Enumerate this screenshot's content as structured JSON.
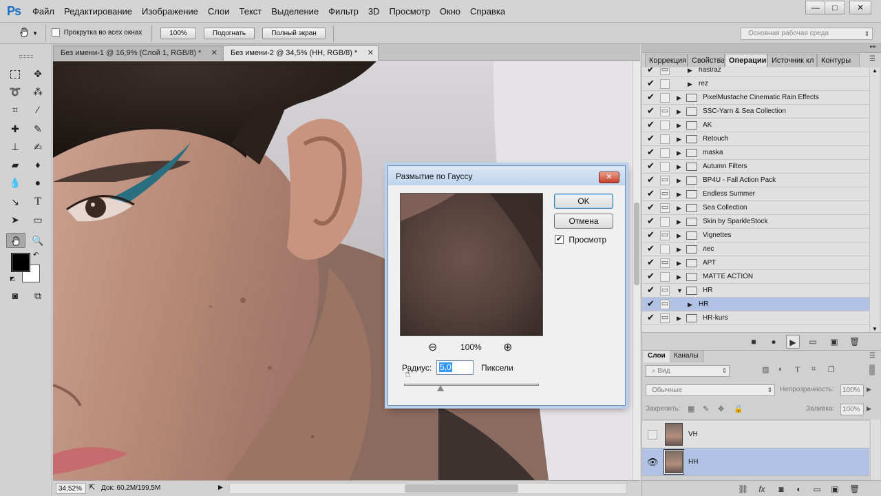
{
  "app": {
    "logo": "Ps",
    "menu": [
      "Файл",
      "Редактирование",
      "Изображение",
      "Слои",
      "Текст",
      "Выделение",
      "Фильтр",
      "3D",
      "Просмотр",
      "Окно",
      "Справка"
    ],
    "window_buttons": [
      "—",
      "□",
      "✕"
    ]
  },
  "options_bar": {
    "scroll_all_label": "Прокрутка во всех окнах",
    "zoom100_label": "100%",
    "fit_label": "Подогнать",
    "fullscreen_label": "Полный экран",
    "workspace": "Основная рабочая среда"
  },
  "documents": {
    "tabs": [
      {
        "title": "Без имени-1 @ 16,9% (Слой 1, RGB/8) *",
        "close": "✕"
      },
      {
        "title": "Без имени-2 @ 34,5% (HH, RGB/8) *",
        "close": "✕"
      }
    ],
    "active_tab": 1
  },
  "statusbar": {
    "zoom": "34,52%",
    "doc": "Док: 60,2M/199,5M"
  },
  "dialog": {
    "title": "Размытие по Гауссу",
    "close": "✕",
    "ok_label": "OK",
    "cancel_label": "Отмена",
    "preview_label": "Просмотр",
    "preview_checked": true,
    "preview_zoom": "100%",
    "zoom_out_icon": "⊖",
    "zoom_in_icon": "⊕",
    "radius_label": "Радиус:",
    "radius_value": "5,0",
    "radius_unit": "Пиксели"
  },
  "panels": {
    "tabs": [
      "Коррекция",
      "Свойства",
      "Операции",
      "Источник кл",
      "Контуры"
    ],
    "active_tab": 2,
    "actions": [
      {
        "label": "hastraz",
        "checked": true,
        "dialog": true,
        "level": 1,
        "type": "action",
        "open": false
      },
      {
        "label": "rez",
        "checked": true,
        "dialog": false,
        "level": 1,
        "type": "action",
        "open": false
      },
      {
        "label": "PixelMustache Cinematic Rain Effects",
        "checked": true,
        "dialog": false,
        "level": 0,
        "type": "set",
        "open": false
      },
      {
        "label": "SSC-Yarn & Sea Collection",
        "checked": true,
        "dialog": true,
        "level": 0,
        "type": "set",
        "open": false
      },
      {
        "label": "AK",
        "checked": true,
        "dialog": false,
        "level": 0,
        "type": "set",
        "open": false
      },
      {
        "label": "Retouch",
        "checked": true,
        "dialog": false,
        "level": 0,
        "type": "set",
        "open": false
      },
      {
        "label": "maska",
        "checked": true,
        "dialog": false,
        "level": 0,
        "type": "set",
        "open": false
      },
      {
        "label": "Autumn Filters",
        "checked": true,
        "dialog": false,
        "level": 0,
        "type": "set",
        "open": false
      },
      {
        "label": "BP4U - Fall Action Pack",
        "checked": true,
        "dialog": true,
        "level": 0,
        "type": "set",
        "open": false
      },
      {
        "label": "Endless Summer",
        "checked": true,
        "dialog": true,
        "level": 0,
        "type": "set",
        "open": false
      },
      {
        "label": "Sea Collection",
        "checked": true,
        "dialog": true,
        "level": 0,
        "type": "set",
        "open": false
      },
      {
        "label": "Skin by SparkleStock",
        "checked": true,
        "dialog": false,
        "level": 0,
        "type": "set",
        "open": false
      },
      {
        "label": "Vignettes",
        "checked": true,
        "dialog": true,
        "level": 0,
        "type": "set",
        "open": false
      },
      {
        "label": "лес",
        "checked": true,
        "dialog": false,
        "level": 0,
        "type": "set",
        "open": false
      },
      {
        "label": "АРТ",
        "checked": true,
        "dialog": true,
        "level": 0,
        "type": "set",
        "open": false
      },
      {
        "label": "MATTE ACTION",
        "checked": true,
        "dialog": false,
        "level": 0,
        "type": "set",
        "open": false
      },
      {
        "label": "HR",
        "checked": true,
        "dialog": true,
        "level": 0,
        "type": "set",
        "open": true
      },
      {
        "label": "HR",
        "checked": true,
        "dialog": true,
        "level": 1,
        "type": "action",
        "open": false,
        "selected": true
      },
      {
        "label": "HR-kurs",
        "checked": true,
        "dialog": true,
        "level": 0,
        "type": "set",
        "open": false
      }
    ],
    "footer_icons": [
      "■",
      "●",
      "▶",
      "▭",
      "▣",
      "🗑"
    ]
  },
  "layers": {
    "tabs": [
      "Слои",
      "Каналы"
    ],
    "active_tab": 0,
    "filter_label": "Вид",
    "blend_mode": "Обычные",
    "opacity_label": "Непрозрачность:",
    "opacity_value": "100%",
    "lock_label": "Закрепить:",
    "fill_label": "Заливка:",
    "fill_value": "100%",
    "items": [
      {
        "name": "VH",
        "visible": false,
        "selected": false
      },
      {
        "name": "HH",
        "visible": true,
        "selected": true
      }
    ],
    "footer_icons": [
      "⛓",
      "fx",
      "◙",
      "◐",
      "▭",
      "▣",
      "🗑"
    ]
  }
}
